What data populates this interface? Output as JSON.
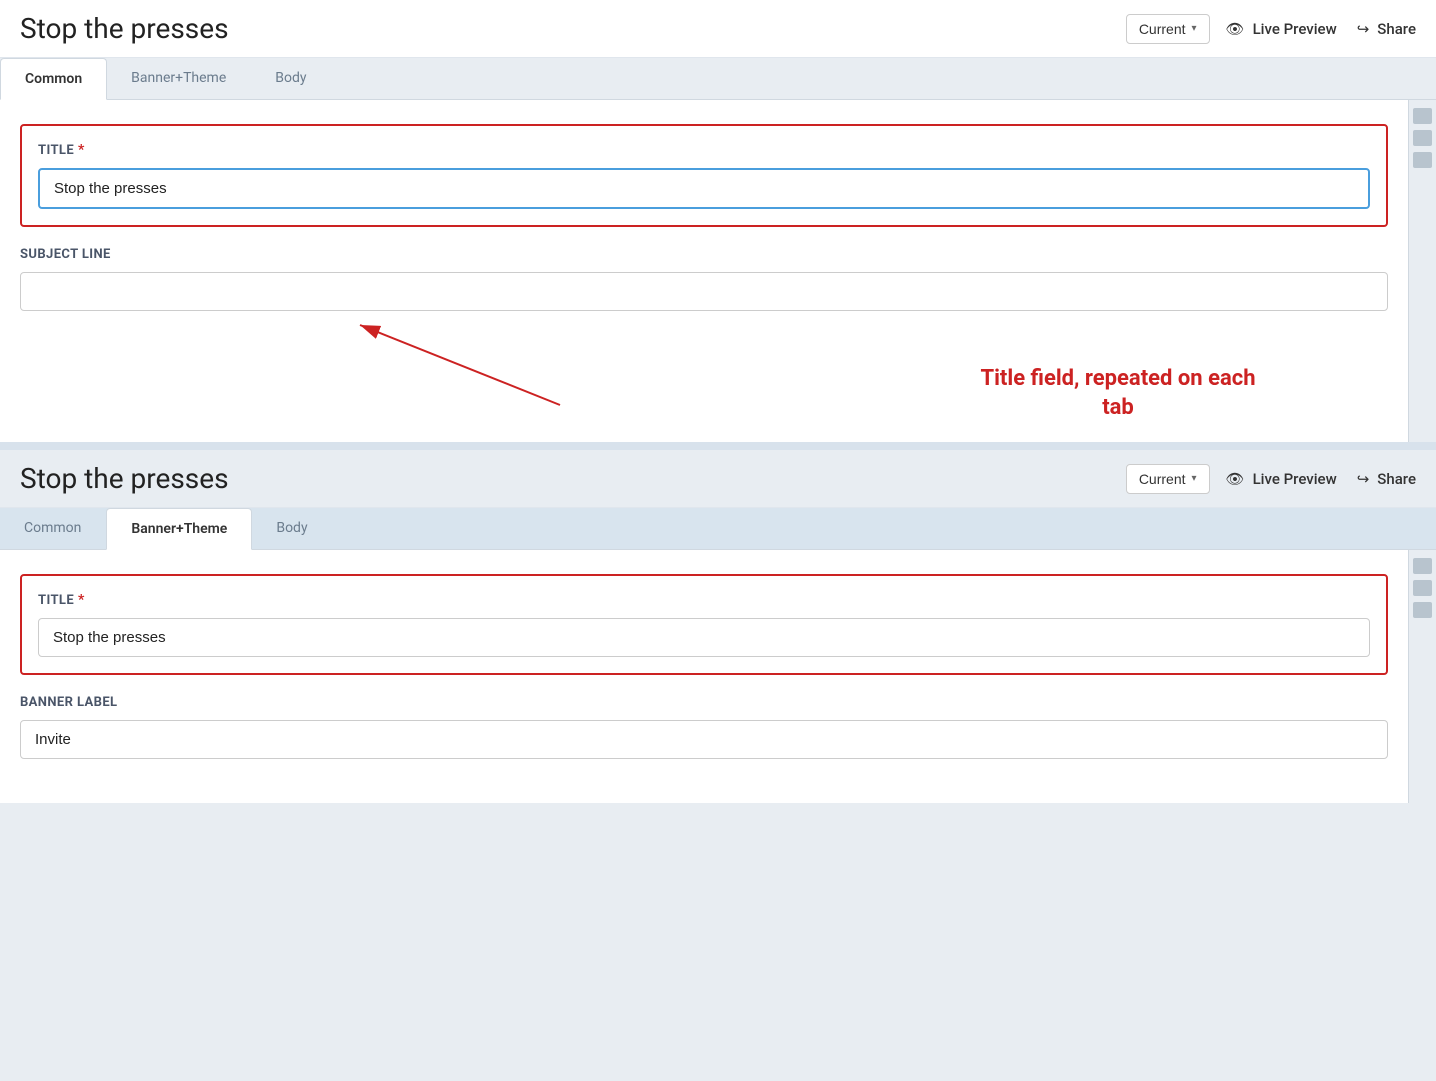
{
  "app": {
    "title": "Stop the presses"
  },
  "header": {
    "title": "Stop the presses",
    "version_label": "Current",
    "version_chevron": "▾",
    "live_preview_label": "Live Preview",
    "share_label": "Share"
  },
  "tabs": {
    "items": [
      {
        "id": "common",
        "label": "Common",
        "active_top": true,
        "active_bottom": false
      },
      {
        "id": "banner-theme",
        "label": "Banner+Theme",
        "active_top": false,
        "active_bottom": true
      },
      {
        "id": "body",
        "label": "Body",
        "active_top": false,
        "active_bottom": false
      }
    ]
  },
  "top_panel": {
    "title_field": {
      "label": "Title",
      "required": "*",
      "value": "Stop the presses",
      "placeholder": ""
    },
    "subject_line_field": {
      "label": "Subject Line",
      "value": "",
      "placeholder": ""
    }
  },
  "bottom_panel": {
    "title_field": {
      "label": "Title",
      "required": "*",
      "value": "Stop the presses",
      "placeholder": ""
    },
    "banner_label_field": {
      "label": "Banner Label",
      "value": "Invite",
      "placeholder": ""
    }
  },
  "annotation": {
    "text": "Title field, repeated on each tab",
    "color": "#cc2222"
  },
  "icons": {
    "eye": "👁",
    "share": "↪"
  }
}
